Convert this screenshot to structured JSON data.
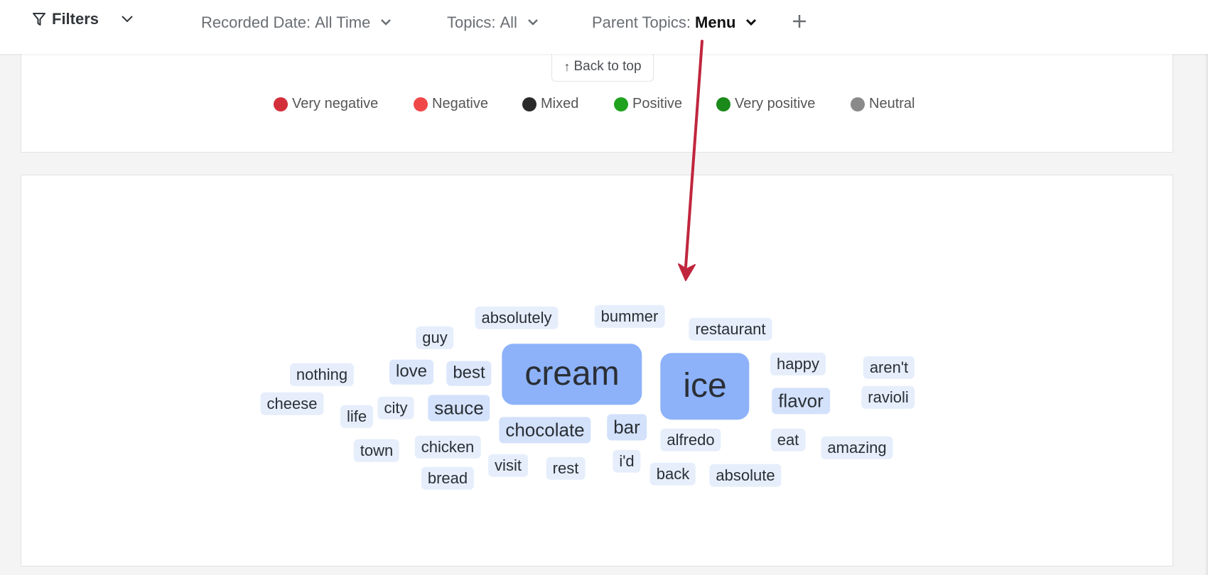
{
  "filters": {
    "label": "Filters",
    "icon": "funnel-icon",
    "chips": [
      {
        "key": "Recorded Date:",
        "value": "All Time"
      },
      {
        "key": "Topics:",
        "value": "All"
      },
      {
        "key": "Parent Topics:",
        "value": "Menu"
      }
    ]
  },
  "back_to_top": {
    "arrow": "↑",
    "label": "Back to top"
  },
  "legend": [
    {
      "label": "Very negative",
      "color": "#d32f3a"
    },
    {
      "label": "Negative",
      "color": "#f04848"
    },
    {
      "label": "Mixed",
      "color": "#2a2a2a"
    },
    {
      "label": "Positive",
      "color": "#1fa31f"
    },
    {
      "label": "Very positive",
      "color": "#1a8a1a"
    },
    {
      "label": "Neutral",
      "color": "#8a8a8a"
    }
  ],
  "annotation_arrow_color": "#c0263d",
  "word_cloud": {
    "words": [
      "absolutely",
      "bummer",
      "restaurant",
      "guy",
      "nothing",
      "love",
      "best",
      "cream",
      "ice",
      "happy",
      "aren't",
      "cheese",
      "sauce",
      "city",
      "life",
      "flavor",
      "ravioli",
      "chocolate",
      "bar",
      "alfredo",
      "eat",
      "amazing",
      "town",
      "chicken",
      "visit",
      "rest",
      "i'd",
      "back",
      "absolute",
      "bread"
    ]
  }
}
